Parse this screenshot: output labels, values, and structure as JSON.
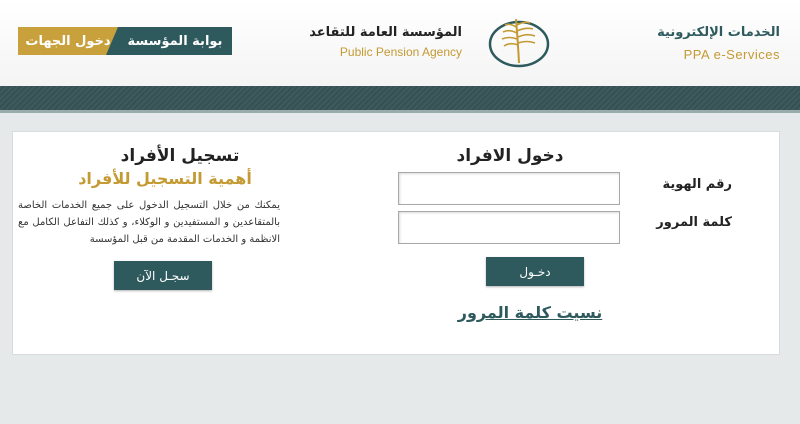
{
  "header": {
    "portal_label": "بوابة المؤسسة",
    "entities_login_label": "دخول الجهات",
    "agency_name_ar": "المؤسسة العامة للتقاعد",
    "agency_name_en": "Public Pension Agency",
    "eservices_ar": "الخدمات الإلكترونية",
    "eservices_en": "PPA  e-Services",
    "logo_icon": "palm-leaf-logo-icon"
  },
  "login": {
    "title": "دخول الافراد",
    "id_label": "رقم الهوية",
    "id_value": "",
    "password_label": "كلمة المرور",
    "password_value": "",
    "submit_label": "دخـول",
    "forgot_label": "نسيت كلمة المرور"
  },
  "register": {
    "title": "تسجيل الأفراد",
    "subtitle": "أهمية التسجيل للأفراد",
    "description": "يمكنك من خلال التسجيل الدخول على جميع الخدمات الخاصة بالمتقاعدين و المستفيدين و الوكلاء، و كذلك التفاعل الكامل مع الانظمة و الخدمات المقدمة من قبل المؤسسة",
    "button_label": "سجـل الآن"
  },
  "colors": {
    "teal": "#2e5a5e",
    "gold": "#c9a13c",
    "band": "#3e5a5c"
  }
}
